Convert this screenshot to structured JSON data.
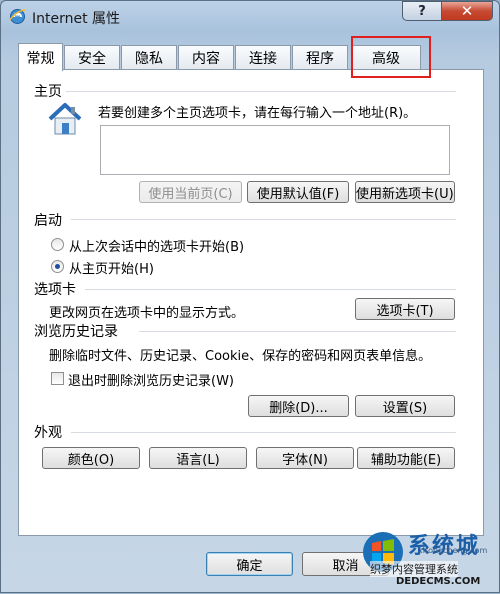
{
  "window": {
    "title": "Internet 属性",
    "help_label": "?",
    "close_label": "✕"
  },
  "tabs": [
    {
      "label": "常规",
      "active": true
    },
    {
      "label": "安全"
    },
    {
      "label": "隐私"
    },
    {
      "label": "内容"
    },
    {
      "label": "连接"
    },
    {
      "label": "程序"
    },
    {
      "label": "高级"
    }
  ],
  "home": {
    "group_label": "主页",
    "instruction": "若要创建多个主页选项卡，请在每行输入一个地址(R)。",
    "textarea_value": "",
    "use_current_label": "使用当前页(C)",
    "use_default_label": "使用默认值(F)",
    "use_new_tab_label": "使用新选项卡(U)"
  },
  "startup": {
    "group_label": "启动",
    "option_last_session": "从上次会话中的选项卡开始(B)",
    "option_home": "从主页开始(H)",
    "selected": "option_home"
  },
  "tabs_group": {
    "group_label": "选项卡",
    "description": "更改网页在选项卡中的显示方式。",
    "button_label": "选项卡(T)"
  },
  "history": {
    "group_label": "浏览历史记录",
    "description": "删除临时文件、历史记录、Cookie、保存的密码和网页表单信息。",
    "checkbox_label": "退出时删除浏览历史记录(W)",
    "checkbox_checked": false,
    "delete_label": "删除(D)...",
    "settings_label": "设置(S)"
  },
  "appearance": {
    "group_label": "外观",
    "colors_label": "颜色(O)",
    "languages_label": "语言(L)",
    "fonts_label": "字体(N)",
    "accessibility_label": "辅助功能(E)"
  },
  "footer": {
    "ok_label": "确定",
    "cancel_label": "取消"
  },
  "watermark": {
    "brand": "系统城",
    "line1": "织梦内容管理系统",
    "line2": "DEDECMS.COM",
    "line3": "xitongcheng.com"
  },
  "colors": {
    "highlight_box": "#e0201e",
    "close_button": "#c74a33"
  },
  "icons": [
    "ie-icon",
    "house-icon",
    "windows-logo-icon"
  ]
}
